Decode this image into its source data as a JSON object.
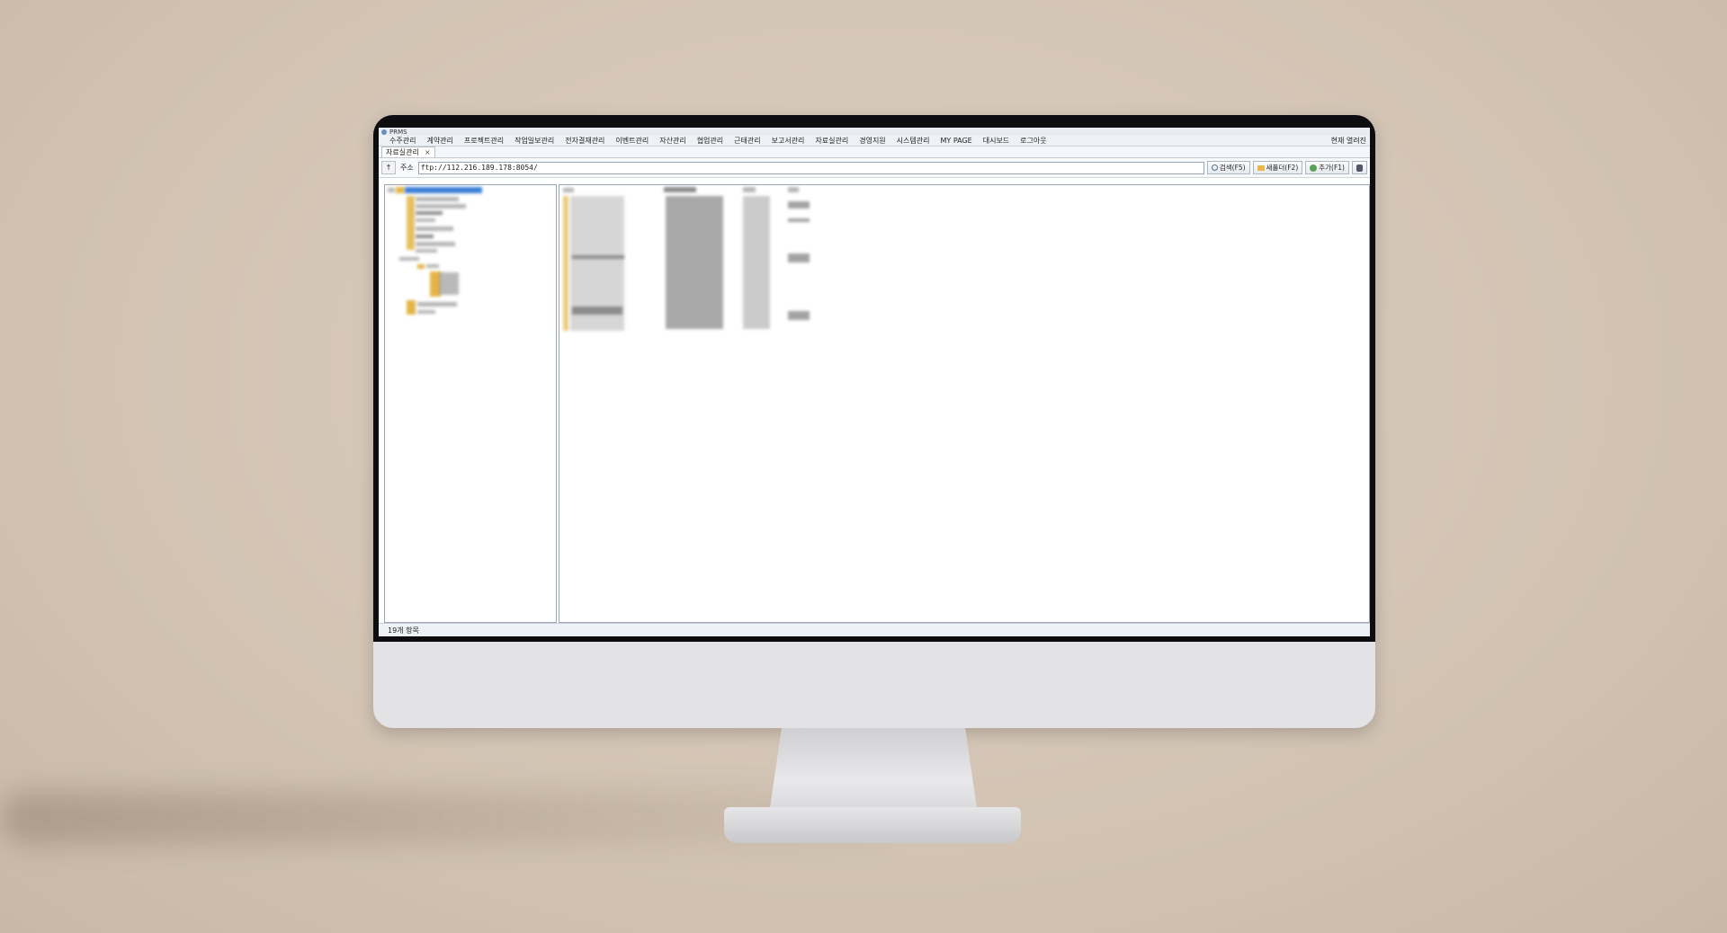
{
  "app": {
    "title": "PRMS"
  },
  "menu": [
    "수주관리",
    "계약관리",
    "프로젝트관리",
    "작업일보관리",
    "전자결재관리",
    "이벤트관리",
    "자산관리",
    "협업관리",
    "근태관리",
    "보고서관리",
    "자료실관리",
    "경영지원",
    "시스템관리",
    "MY PAGE",
    "대시보드",
    "로그아웃"
  ],
  "menu_right": "현재 열려진",
  "tab": {
    "label": "자료실관리",
    "close": "×"
  },
  "address": {
    "up": "↑",
    "label": "주소",
    "value": "ftp://112.216.189.178:8054/"
  },
  "buttons": {
    "search": "검색(F5)",
    "new_folder": "새폴더(F2)",
    "add": "추가(F1)"
  },
  "status": "19개 항목",
  "colors": {
    "accent": "#3b7fd6",
    "folder": "#e4b544"
  },
  "icons": {
    "search": "search-icon",
    "new_folder": "folder-icon",
    "add": "add-icon",
    "db": "database-icon"
  }
}
